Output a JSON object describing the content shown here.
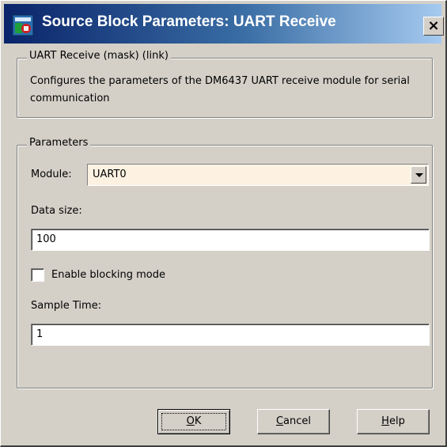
{
  "window": {
    "title": "Source Block Parameters: UART Receive",
    "close_label": "×"
  },
  "mask": {
    "group_title": "UART Receive (mask) (link)",
    "description": "Configures the parameters of the DM6437 UART receive module for serial communication"
  },
  "parameters": {
    "group_title": "Parameters",
    "module_label": "Module:",
    "module_value": "UART0",
    "data_size_label": "Data size:",
    "data_size_value": "100",
    "blocking_label": "Enable blocking mode",
    "blocking_checked": false,
    "sample_time_label": "Sample Time:",
    "sample_time_value": "1"
  },
  "buttons": {
    "ok_mnemonic": "O",
    "ok_rest": "K",
    "cancel_mnemonic": "C",
    "cancel_rest": "ancel",
    "help_mnemonic": "H",
    "help_rest": "elp"
  },
  "icons": {
    "app": "simulink-block-icon",
    "close": "close-icon",
    "dropdown": "chevron-down-icon"
  }
}
